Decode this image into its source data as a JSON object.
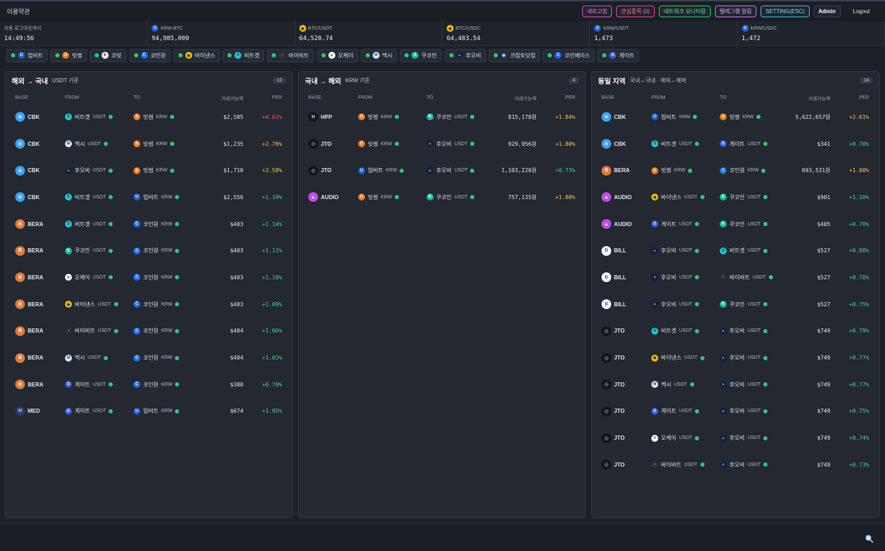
{
  "header": {
    "title": "이용약관",
    "buttons": [
      {
        "label": "새로고침",
        "color": "#e84bbf"
      },
      {
        "label": "관심종목 (0)",
        "color": "#e84b8a"
      },
      {
        "label": "네트워크 모니터링",
        "color": "#2ecc71"
      },
      {
        "label": "텔레그램 알림",
        "color": "#c77dff"
      },
      {
        "label": "SETTING(ESC)",
        "color": "#3ec6e0"
      }
    ],
    "admin": "Admin",
    "logout": "Logout"
  },
  "tickers": [
    {
      "label": "자동 로그아웃까지",
      "value": "14:49:56",
      "icon": ""
    },
    {
      "label": "KRW-BTC",
      "value": "94,985,000",
      "icon": "upbit"
    },
    {
      "label": "BTC/USDT",
      "value": "64,520.74",
      "icon": "binance"
    },
    {
      "label": "BTC/USDC",
      "value": "64,483.54",
      "icon": "binance"
    },
    {
      "label": "KRW/USDT",
      "value": "1,473",
      "icon": "upbit"
    },
    {
      "label": "KRW/USDC",
      "value": "1,472",
      "icon": "upbit"
    }
  ],
  "exchanges": [
    {
      "name": "업비트",
      "icon": "upbit"
    },
    {
      "name": "빗썸",
      "icon": "bithumb"
    },
    {
      "name": "코빗",
      "icon": "korbit"
    },
    {
      "name": "코인원",
      "icon": "coinone"
    },
    {
      "name": "바이낸스",
      "icon": "binance"
    },
    {
      "name": "비트겟",
      "icon": "bitget"
    },
    {
      "name": "바이비트",
      "icon": "bybit"
    },
    {
      "name": "오케이",
      "icon": "okx"
    },
    {
      "name": "멕시",
      "icon": "mexc"
    },
    {
      "name": "쿠코인",
      "icon": "kucoin"
    },
    {
      "name": "후오비",
      "icon": "huobi"
    },
    {
      "name": "크립토닷컴",
      "icon": "cryptocom"
    },
    {
      "name": "코인베이스",
      "icon": "coinbase"
    },
    {
      "name": "게이트",
      "icon": "gate"
    }
  ],
  "columns": {
    "base": "BASE",
    "from": "FROM",
    "to": "TO",
    "amount": "거래가능액",
    "per": "PER"
  },
  "panels": [
    {
      "title": "해외 → 국내",
      "subtitle": "USDT 기준",
      "count": "12",
      "rows": [
        {
          "base": "CBK",
          "base_icon": "cbk",
          "from": "비트겟",
          "from_icon": "bitget",
          "from_cur": "USDT",
          "to": "빗썸",
          "to_icon": "bithumb",
          "to_cur": "KRW",
          "amount": "$2,585",
          "per": "+4.61%",
          "per_color": "#ff5a5a"
        },
        {
          "base": "CBK",
          "base_icon": "cbk",
          "from": "멕시",
          "from_icon": "mexc",
          "from_cur": "USDT",
          "to": "빗썸",
          "to_icon": "bithumb",
          "to_cur": "KRW",
          "amount": "$1,235",
          "per": "+2.76%",
          "per_color": "#ffc94a"
        },
        {
          "base": "CBK",
          "base_icon": "cbk",
          "from": "후오비",
          "from_icon": "huobi",
          "from_cur": "USDT",
          "to": "빗썸",
          "to_icon": "bithumb",
          "to_cur": "KRW",
          "amount": "$1,710",
          "per": "+2.58%",
          "per_color": "#ffc94a"
        },
        {
          "base": "CBK",
          "base_icon": "cbk",
          "from": "비트겟",
          "from_icon": "bitget",
          "from_cur": "USDT",
          "to": "업비트",
          "to_icon": "upbit",
          "to_cur": "KRW",
          "amount": "$2,556",
          "per": "+1.19%",
          "per_color": "#3ee07a"
        },
        {
          "base": "BERA",
          "base_icon": "bera",
          "from": "비트겟",
          "from_icon": "bitget",
          "from_cur": "USDT",
          "to": "코인원",
          "to_icon": "coinone",
          "to_cur": "KRW",
          "amount": "$403",
          "per": "+1.14%",
          "per_color": "#3ee07a"
        },
        {
          "base": "BERA",
          "base_icon": "bera",
          "from": "쿠코인",
          "from_icon": "kucoin",
          "from_cur": "USDT",
          "to": "코인원",
          "to_icon": "coinone",
          "to_cur": "KRW",
          "amount": "$403",
          "per": "+1.11%",
          "per_color": "#3ee07a"
        },
        {
          "base": "BERA",
          "base_icon": "bera",
          "from": "오케이",
          "from_icon": "okx",
          "from_cur": "USDT",
          "to": "코인원",
          "to_icon": "coinone",
          "to_cur": "KRW",
          "amount": "$403",
          "per": "+1.10%",
          "per_color": "#3ee07a"
        },
        {
          "base": "BERA",
          "base_icon": "bera",
          "from": "바이낸스",
          "from_icon": "binance",
          "from_cur": "USDT",
          "to": "코인원",
          "to_icon": "coinone",
          "to_cur": "KRW",
          "amount": "$403",
          "per": "+1.09%",
          "per_color": "#3ee07a"
        },
        {
          "base": "BERA",
          "base_icon": "bera",
          "from": "바이비트",
          "from_icon": "bybit",
          "from_cur": "USDT",
          "to": "코인원",
          "to_icon": "coinone",
          "to_cur": "KRW",
          "amount": "$404",
          "per": "+1.06%",
          "per_color": "#3ee07a"
        },
        {
          "base": "BERA",
          "base_icon": "bera",
          "from": "멕시",
          "from_icon": "mexc",
          "from_cur": "USDT",
          "to": "코인원",
          "to_icon": "coinone",
          "to_cur": "KRW",
          "amount": "$404",
          "per": "+1.03%",
          "per_color": "#3ee07a"
        },
        {
          "base": "BERA",
          "base_icon": "bera",
          "from": "게이트",
          "from_icon": "gate",
          "from_cur": "USDT",
          "to": "코인원",
          "to_icon": "coinone",
          "to_cur": "KRW",
          "amount": "$380",
          "per": "+0.70%",
          "per_color": "#3ee07a"
        },
        {
          "base": "MED",
          "base_icon": "med",
          "from": "게이트",
          "from_icon": "gate",
          "from_cur": "USDT",
          "to": "업비트",
          "to_icon": "upbit",
          "to_cur": "KRW",
          "amount": "$674",
          "per": "+1.05%",
          "per_color": "#3ee07a"
        }
      ]
    },
    {
      "title": "국내 → 해외",
      "subtitle": "KRW 기준",
      "count": "4",
      "rows": [
        {
          "base": "HPP",
          "base_icon": "hpp",
          "from": "빗썸",
          "from_icon": "bithumb",
          "from_cur": "KRW",
          "to": "쿠코인",
          "to_icon": "kucoin",
          "to_cur": "USDT",
          "amount": "815,178원",
          "per": "+1.84%",
          "per_color": "#ffc94a"
        },
        {
          "base": "JTO",
          "base_icon": "jto",
          "from": "빗썸",
          "from_icon": "bithumb",
          "from_cur": "KRW",
          "to": "후오비",
          "to_icon": "huobi",
          "to_cur": "USDT",
          "amount": "929,956원",
          "per": "+1.80%",
          "per_color": "#ffc94a"
        },
        {
          "base": "JTO",
          "base_icon": "jto",
          "from": "업비트",
          "from_icon": "upbit",
          "from_cur": "KRW",
          "to": "후오비",
          "to_icon": "huobi",
          "to_cur": "USDT",
          "amount": "1,103,220원",
          "per": "+0.73%",
          "per_color": "#3ee07a"
        },
        {
          "base": "AUDIO",
          "base_icon": "audio",
          "from": "빗썸",
          "from_icon": "bithumb",
          "from_cur": "KRW",
          "to": "쿠코인",
          "to_icon": "kucoin",
          "to_cur": "USDT",
          "amount": "757,135원",
          "per": "+1.80%",
          "per_color": "#ffc94a"
        }
      ]
    },
    {
      "title": "동일 지역",
      "subtitle": "국내↔국내 · 해외↔해외",
      "count": "14",
      "rows": [
        {
          "base": "CBK",
          "base_icon": "cbk",
          "from": "업비트",
          "from_icon": "upbit",
          "from_cur": "KRW",
          "to": "빗썸",
          "to_icon": "bithumb",
          "to_cur": "KRW",
          "amount": "5,622,657원",
          "per": "+2.61%",
          "per_color": "#ffc94a"
        },
        {
          "base": "CBK",
          "base_icon": "cbk",
          "from": "비트겟",
          "from_icon": "bitget",
          "from_cur": "USDT",
          "to": "게이트",
          "to_icon": "gate",
          "to_cur": "USDT",
          "amount": "$341",
          "per": "+0.70%",
          "per_color": "#3ee07a"
        },
        {
          "base": "BERA",
          "base_icon": "bera",
          "from": "빗썸",
          "from_icon": "bithumb",
          "from_cur": "KRW",
          "to": "코인원",
          "to_icon": "coinone",
          "to_cur": "KRW",
          "amount": "693,531원",
          "per": "+1.80%",
          "per_color": "#ffc94a"
        },
        {
          "base": "AUDIO",
          "base_icon": "audio",
          "from": "바이낸스",
          "from_icon": "binance",
          "from_cur": "USDT",
          "to": "쿠코인",
          "to_icon": "kucoin",
          "to_cur": "USDT",
          "amount": "$901",
          "per": "+1.10%",
          "per_color": "#3ee07a"
        },
        {
          "base": "AUDIO",
          "base_icon": "audio",
          "from": "게이트",
          "from_icon": "gate",
          "from_cur": "USDT",
          "to": "쿠코인",
          "to_icon": "kucoin",
          "to_cur": "USDT",
          "amount": "$405",
          "per": "+0.70%",
          "per_color": "#3ee07a"
        },
        {
          "base": "BILL",
          "base_icon": "bill",
          "from": "후오비",
          "from_icon": "huobi",
          "from_cur": "USDT",
          "to": "비트겟",
          "to_icon": "bitget",
          "to_cur": "USDT",
          "amount": "$527",
          "per": "+0.88%",
          "per_color": "#3ee07a"
        },
        {
          "base": "BILL",
          "base_icon": "bill",
          "from": "후오비",
          "from_icon": "huobi",
          "from_cur": "USDT",
          "to": "바이비트",
          "to_icon": "bybit",
          "to_cur": "USDT",
          "amount": "$527",
          "per": "+0.78%",
          "per_color": "#3ee07a"
        },
        {
          "base": "BILL",
          "base_icon": "bill",
          "from": "후오비",
          "from_icon": "huobi",
          "from_cur": "USDT",
          "to": "쿠코인",
          "to_icon": "kucoin",
          "to_cur": "USDT",
          "amount": "$527",
          "per": "+0.75%",
          "per_color": "#3ee07a"
        },
        {
          "base": "JTO",
          "base_icon": "jto",
          "from": "비트겟",
          "from_icon": "bitget",
          "from_cur": "USDT",
          "to": "후오비",
          "to_icon": "huobi",
          "to_cur": "USDT",
          "amount": "$749",
          "per": "+0.79%",
          "per_color": "#3ee07a"
        },
        {
          "base": "JTO",
          "base_icon": "jto",
          "from": "바이낸스",
          "from_icon": "binance",
          "from_cur": "USDT",
          "to": "후오비",
          "to_icon": "huobi",
          "to_cur": "USDT",
          "amount": "$749",
          "per": "+0.77%",
          "per_color": "#3ee07a"
        },
        {
          "base": "JTO",
          "base_icon": "jto",
          "from": "멕시",
          "from_icon": "mexc",
          "from_cur": "USDT",
          "to": "후오비",
          "to_icon": "huobi",
          "to_cur": "USDT",
          "amount": "$749",
          "per": "+0.77%",
          "per_color": "#3ee07a"
        },
        {
          "base": "JTO",
          "base_icon": "jto",
          "from": "게이트",
          "from_icon": "gate",
          "from_cur": "USDT",
          "to": "후오비",
          "to_icon": "huobi",
          "to_cur": "USDT",
          "amount": "$749",
          "per": "+0.75%",
          "per_color": "#3ee07a"
        },
        {
          "base": "JTO",
          "base_icon": "jto",
          "from": "오케이",
          "from_icon": "okx",
          "from_cur": "USDT",
          "to": "후오비",
          "to_icon": "huobi",
          "to_cur": "USDT",
          "amount": "$749",
          "per": "+0.74%",
          "per_color": "#3ee07a"
        },
        {
          "base": "JTO",
          "base_icon": "jto",
          "from": "바이비트",
          "from_icon": "bybit",
          "from_cur": "USDT",
          "to": "후오비",
          "to_icon": "huobi",
          "to_cur": "USDT",
          "amount": "$749",
          "per": "+0.73%",
          "per_color": "#3ee07a"
        }
      ]
    }
  ],
  "footer": {
    "icon": "search-icon"
  }
}
